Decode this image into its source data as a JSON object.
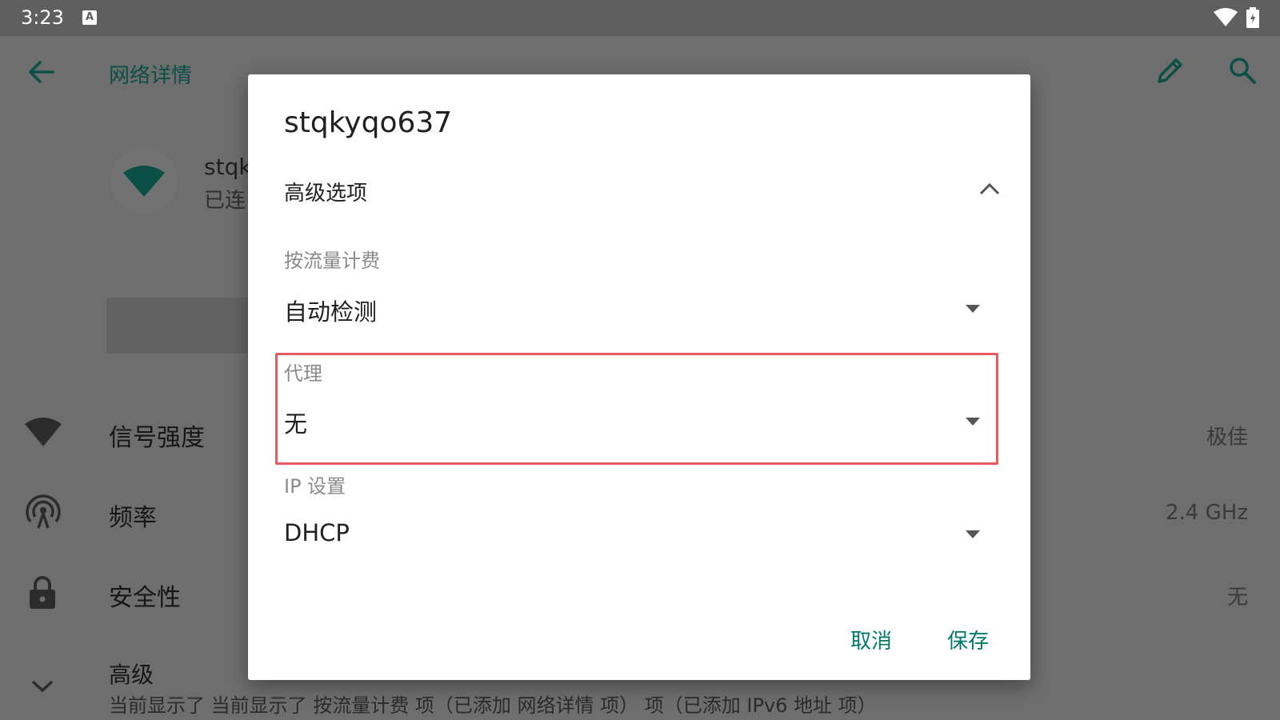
{
  "status_bar": {
    "time": "3:23",
    "notification_letter": "A"
  },
  "app_bar": {
    "title": "网络详情"
  },
  "network": {
    "name_partial": "stqk",
    "status_partial": "已连"
  },
  "details": [
    {
      "label": "信号强度",
      "value": "极佳",
      "icon": "wifi-signal-icon"
    },
    {
      "label": "频率",
      "value": "2.4 GHz",
      "icon": "antenna-icon"
    },
    {
      "label": "安全性",
      "value": "无",
      "icon": "lock-icon"
    }
  ],
  "advanced": {
    "label": "高级",
    "summary": "当前显示了 当前显示了 按流量计费 项（已添加 网络详情 项） 项（已添加 IPv6 地址 项）"
  },
  "dialog": {
    "title": "stqkyqo637",
    "section_title": "高级选项",
    "metered": {
      "label": "按流量计费",
      "value": "自动检测"
    },
    "proxy": {
      "label": "代理",
      "value": "无"
    },
    "ip_settings": {
      "label": "IP 设置",
      "value": "DHCP"
    },
    "cancel_label": "取消",
    "save_label": "保存"
  },
  "colors": {
    "accent": "#00796b",
    "highlight": "#e95a5f",
    "scrim": "#6e6e6e"
  }
}
